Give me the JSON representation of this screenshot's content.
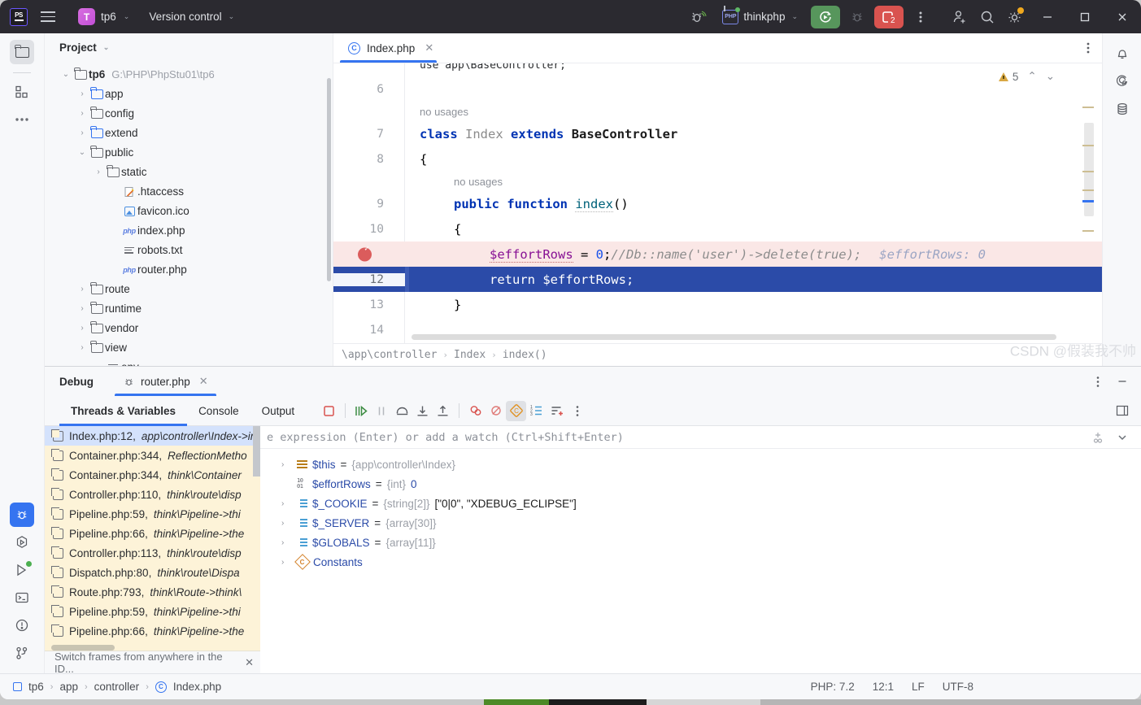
{
  "titlebar": {
    "project_initial": "T",
    "project_name": "tp6",
    "vcs_label": "Version control",
    "run_config": "thinkphp",
    "debug_badge": "2"
  },
  "project_panel": {
    "header": "Project",
    "tree": [
      {
        "label": "tp6",
        "path": "G:\\PHP\\PhpStu01\\tp6",
        "indent": 0,
        "arrow": "down",
        "icon": "folder",
        "bold": true
      },
      {
        "label": "app",
        "path": "",
        "indent": 1,
        "arrow": "right",
        "icon": "folder-blue",
        "bold": false
      },
      {
        "label": "config",
        "path": "",
        "indent": 1,
        "arrow": "right",
        "icon": "folder",
        "bold": false
      },
      {
        "label": "extend",
        "path": "",
        "indent": 1,
        "arrow": "right",
        "icon": "folder-blue",
        "bold": false
      },
      {
        "label": "public",
        "path": "",
        "indent": 1,
        "arrow": "down",
        "icon": "folder",
        "bold": false
      },
      {
        "label": "static",
        "path": "",
        "indent": 2,
        "arrow": "right",
        "icon": "folder",
        "bold": false
      },
      {
        "label": ".htaccess",
        "path": "",
        "indent": 3,
        "arrow": "none",
        "icon": "htaccess",
        "bold": false
      },
      {
        "label": "favicon.ico",
        "path": "",
        "indent": 3,
        "arrow": "none",
        "icon": "image",
        "bold": false
      },
      {
        "label": "index.php",
        "path": "",
        "indent": 3,
        "arrow": "none",
        "icon": "php",
        "bold": false
      },
      {
        "label": "robots.txt",
        "path": "",
        "indent": 3,
        "arrow": "none",
        "icon": "text",
        "bold": false
      },
      {
        "label": "router.php",
        "path": "",
        "indent": 3,
        "arrow": "none",
        "icon": "php",
        "bold": false
      },
      {
        "label": "route",
        "path": "",
        "indent": 1,
        "arrow": "right",
        "icon": "folder",
        "bold": false
      },
      {
        "label": "runtime",
        "path": "",
        "indent": 1,
        "arrow": "right",
        "icon": "folder",
        "bold": false
      },
      {
        "label": "vendor",
        "path": "",
        "indent": 1,
        "arrow": "right",
        "icon": "folder",
        "bold": false
      },
      {
        "label": "view",
        "path": "",
        "indent": 1,
        "arrow": "right",
        "icon": "folder",
        "bold": false
      },
      {
        "label": "env",
        "path": "",
        "indent": 2,
        "arrow": "none",
        "icon": "text",
        "bold": false
      }
    ]
  },
  "editor": {
    "tab_label": "Index.php",
    "warning_count": "5",
    "lines": [
      {
        "num": "6",
        "kind": "blank"
      },
      {
        "num": "",
        "kind": "usage",
        "text": "no usages",
        "indent": 0
      },
      {
        "num": "7",
        "kind": "code1"
      },
      {
        "num": "8",
        "kind": "brace_open"
      },
      {
        "num": "",
        "kind": "usage",
        "text": "no usages",
        "indent": 1
      },
      {
        "num": "9",
        "kind": "code_fn"
      },
      {
        "num": "10",
        "kind": "brace_open2"
      },
      {
        "num": "",
        "kind": "code_bp"
      },
      {
        "num": "12",
        "kind": "code_sel"
      },
      {
        "num": "13",
        "kind": "brace_close"
      },
      {
        "num": "14",
        "kind": "blank"
      }
    ],
    "code": {
      "l7_kw": "class",
      "l7_name": "Index",
      "l7_kw2": "extends",
      "l7_base": "BaseController",
      "l8": "{",
      "l9_kw": "public",
      "l9_kw2": "function",
      "l9_name": "index",
      "l9_parens": "()",
      "l10": "{",
      "l11_var": "$effortRows",
      "l11_eq": " = ",
      "l11_num": "0",
      "l11_semi": ";",
      "l11_comment": "//Db::name('user')->delete(true);",
      "l11_hint": "$effortRows: 0",
      "l12": "return $effortRows;",
      "l13": "}"
    },
    "breadcrumb": [
      "\\app\\controller",
      "Index",
      "index()"
    ]
  },
  "debug": {
    "panel_title": "Debug",
    "file_tab": "router.php",
    "tabs": [
      "Threads & Variables",
      "Console",
      "Output"
    ],
    "active_tab": "Threads & Variables",
    "frames": [
      {
        "file": "Index.php:12,",
        "sig": "app\\controller\\Index->index()",
        "selected": true
      },
      {
        "file": "Container.php:344,",
        "sig": "ReflectionMetho",
        "selected": false
      },
      {
        "file": "Container.php:344,",
        "sig": "think\\Container",
        "selected": false
      },
      {
        "file": "Controller.php:110,",
        "sig": "think\\route\\disp",
        "selected": false
      },
      {
        "file": "Pipeline.php:59,",
        "sig": "think\\Pipeline->thi",
        "selected": false
      },
      {
        "file": "Pipeline.php:66,",
        "sig": "think\\Pipeline->the",
        "selected": false
      },
      {
        "file": "Controller.php:113,",
        "sig": "think\\route\\disp",
        "selected": false
      },
      {
        "file": "Dispatch.php:80,",
        "sig": "think\\route\\Dispa",
        "selected": false
      },
      {
        "file": "Route.php:793,",
        "sig": "think\\Route->think\\",
        "selected": false
      },
      {
        "file": "Pipeline.php:59,",
        "sig": "think\\Pipeline->thi",
        "selected": false
      },
      {
        "file": "Pipeline.php:66,",
        "sig": "think\\Pipeline->the",
        "selected": false
      }
    ],
    "frames_hint": "Switch frames from anywhere in the ID...",
    "watch_placeholder": "e expression (Enter) or add a watch (Ctrl+Shift+Enter)",
    "variables": [
      {
        "arrow": true,
        "icon": "object-icon",
        "name": "$this",
        "eq": "=",
        "type": "{app\\controller\\Index}",
        "value": "",
        "str": ""
      },
      {
        "arrow": false,
        "icon": "number-icon",
        "name": "$effortRows",
        "eq": "=",
        "type": "{int}",
        "value": "0",
        "str": ""
      },
      {
        "arrow": true,
        "icon": "array-icon",
        "name": "$_COOKIE",
        "eq": "=",
        "type": "{string[2]}",
        "value": "",
        "str": "[\"0|0\", \"XDEBUG_ECLIPSE\"]"
      },
      {
        "arrow": true,
        "icon": "array-icon",
        "name": "$_SERVER",
        "eq": "=",
        "type": "{array[30]}",
        "value": "",
        "str": ""
      },
      {
        "arrow": true,
        "icon": "array-icon",
        "name": "$GLOBALS",
        "eq": "=",
        "type": "{array[11]}",
        "value": "",
        "str": ""
      },
      {
        "arrow": true,
        "icon": "constants-icon",
        "name": "Constants",
        "eq": "",
        "type": "",
        "value": "",
        "str": ""
      }
    ]
  },
  "statusbar": {
    "breadcrumb": [
      "tp6",
      "app",
      "controller",
      "Index.php"
    ],
    "php_version": "PHP: 7.2",
    "caret": "12:1",
    "line_sep": "LF",
    "encoding": "UTF-8",
    "watermark_left": "CSDN",
    "watermark_right": "@假装我不帅"
  },
  "colors": {
    "accent": "#3574f0",
    "titlebar_bg": "#2b2a30",
    "selection_blue": "#2b4ba8",
    "breakpoint_red": "#db5c5c",
    "frames_bg": "#fdf3d8"
  }
}
